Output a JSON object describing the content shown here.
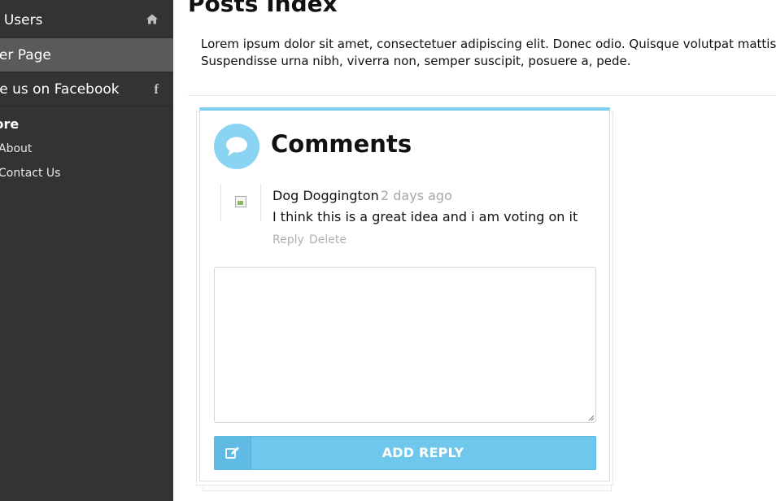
{
  "sidebar": {
    "items": [
      {
        "label": "ll Users",
        "icon": "home-icon"
      },
      {
        "label": "ser Page"
      },
      {
        "label": "ke us on Facebook",
        "icon": "facebook-icon"
      }
    ],
    "section_title": "lore",
    "sub_items": [
      {
        "label": "About"
      },
      {
        "label": "Contact Us"
      }
    ]
  },
  "main": {
    "title": "Posts Index",
    "intro_line1": "Lorem ipsum dolor sit amet, consectetuer adipiscing elit. Donec odio. Quisque volutpat mattis",
    "intro_line2": "Suspendisse urna nibh, viverra non, semper suscipit, posuere a, pede."
  },
  "comments": {
    "title": "Comments",
    "icon": "chat-bubble-icon",
    "accent_color": "#7fd0ee",
    "items": [
      {
        "author": "Dog Doggington",
        "time": "2 days ago",
        "body": "I think this is a great idea and i am voting on it",
        "actions": {
          "reply": "Reply",
          "delete": "Delete"
        }
      }
    ],
    "reply_box": {
      "value": "",
      "placeholder": ""
    },
    "submit": {
      "label": "ADD REPLY",
      "icon": "edit-icon",
      "color": "#6fc8ec"
    }
  }
}
